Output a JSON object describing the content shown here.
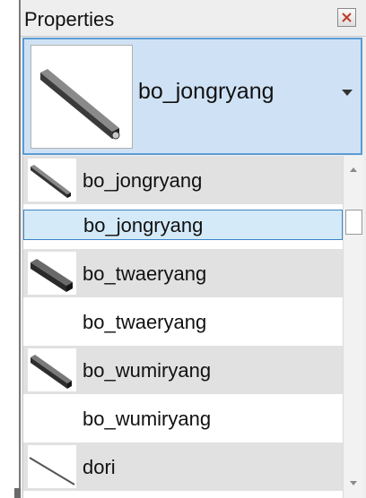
{
  "panel": {
    "title": "Properties",
    "close_icon": "close-icon"
  },
  "type_selector": {
    "selected_label": "bo_jongryang",
    "dropdown_icon": "dropdown-arrow-icon"
  },
  "family_list": {
    "items": [
      {
        "label": "bo_jongryang",
        "has_thumbnail": true,
        "thumbnail_icon": "beam-icon",
        "selected": false
      },
      {
        "label": "bo_jongryang",
        "has_thumbnail": false,
        "selected": true
      },
      {
        "label": "bo_twaeryang",
        "has_thumbnail": true,
        "thumbnail_icon": "beam-icon",
        "selected": false
      },
      {
        "label": "bo_twaeryang",
        "has_thumbnail": false,
        "selected": false
      },
      {
        "label": "bo_wumiryang",
        "has_thumbnail": true,
        "thumbnail_icon": "beam-icon",
        "selected": false
      },
      {
        "label": "bo_wumiryang",
        "has_thumbnail": false,
        "selected": false
      },
      {
        "label": "dori",
        "has_thumbnail": true,
        "thumbnail_icon": "rod-icon",
        "selected": false
      }
    ]
  },
  "colors": {
    "selection_fill": "#cfe2f5",
    "selection_border": "#5b9bd5",
    "row_shade": "#e1e1e1"
  }
}
